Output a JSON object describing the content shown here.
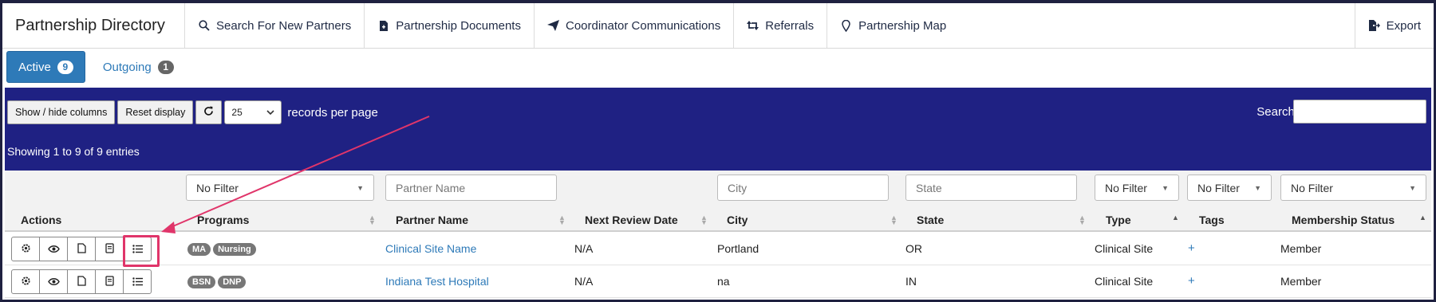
{
  "nav": {
    "brand": "Partnership Directory",
    "items": [
      {
        "label": "Search For New Partners",
        "icon": "search-icon"
      },
      {
        "label": "Partnership Documents",
        "icon": "document-icon"
      },
      {
        "label": "Coordinator Communications",
        "icon": "paper-plane-icon"
      },
      {
        "label": "Referrals",
        "icon": "retweet-icon"
      },
      {
        "label": "Partnership Map",
        "icon": "map-pin-icon"
      }
    ],
    "export_label": "Export"
  },
  "tabs": [
    {
      "label": "Active",
      "count": "9"
    },
    {
      "label": "Outgoing",
      "count": "1"
    }
  ],
  "toolbar": {
    "show_hide": "Show / hide columns",
    "reset": "Reset display",
    "page_size": "25",
    "records_per_page": "records per page",
    "search_label": "Search:",
    "search_value": "",
    "showing": "Showing 1 to 9 of 9 entries"
  },
  "filters": {
    "programs": "No Filter",
    "partner_name_placeholder": "Partner Name",
    "city_placeholder": "City",
    "state_placeholder": "State",
    "type": "No Filter",
    "tags": "No Filter",
    "membership": "No Filter"
  },
  "columns": {
    "actions": "Actions",
    "programs": "Programs",
    "partner_name": "Partner Name",
    "next_review": "Next Review Date",
    "city": "City",
    "state": "State",
    "type": "Type",
    "tags": "Tags",
    "membership": "Membership Status"
  },
  "rows": [
    {
      "programs": [
        "MA",
        "Nursing"
      ],
      "partner_name": "Clinical Site Name",
      "next_review": "N/A",
      "city": "Portland",
      "state": "OR",
      "type": "Clinical Site",
      "tags": "+",
      "membership": "Member"
    },
    {
      "programs": [
        "BSN",
        "DNP"
      ],
      "partner_name": "Indiana Test Hospital",
      "next_review": "N/A",
      "city": "na",
      "state": "IN",
      "type": "Clinical Site",
      "tags": "+",
      "membership": "Member"
    }
  ],
  "colors": {
    "panel": "#1f2183",
    "accent": "#2e7ab8",
    "highlight": "#e0356a"
  }
}
